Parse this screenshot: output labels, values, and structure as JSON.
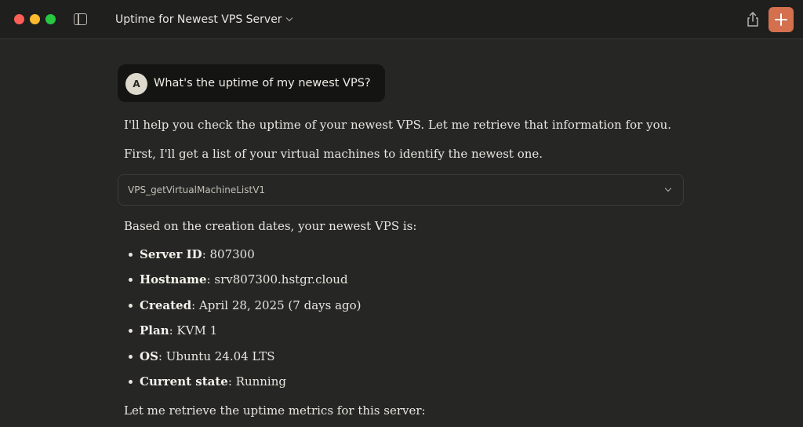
{
  "window": {
    "title": "Uptime for Newest VPS Server"
  },
  "user_message": {
    "avatar_initial": "A",
    "text": "What's the uptime of my newest VPS?"
  },
  "assistant": {
    "intro": "I'll help you check the uptime of your newest VPS. Let me retrieve that information for you.",
    "step1": "First, I'll get a list of your virtual machines to identify the newest one.",
    "tool_call": "VPS_getVirtualMachineListV1",
    "result_intro": "Based on the creation dates, your newest VPS is:",
    "details": [
      {
        "label": "Server ID",
        "value": ": 807300"
      },
      {
        "label": "Hostname",
        "value": ": srv807300.hstgr.cloud"
      },
      {
        "label": "Created",
        "value": ": April 28, 2025 (7 days ago)"
      },
      {
        "label": "Plan",
        "value": ": KVM 1"
      },
      {
        "label": "OS",
        "value": ": Ubuntu 24.04 LTS"
      },
      {
        "label": "Current state",
        "value": ": Running"
      }
    ],
    "next_step": "Let me retrieve the uptime metrics for this server:"
  },
  "colors": {
    "accent": "#d4704e",
    "background": "#262624",
    "titlebar": "#1f1f1e"
  },
  "icons": [
    "sidebar-toggle-icon",
    "chevron-down-icon",
    "share-icon",
    "plus-icon"
  ]
}
